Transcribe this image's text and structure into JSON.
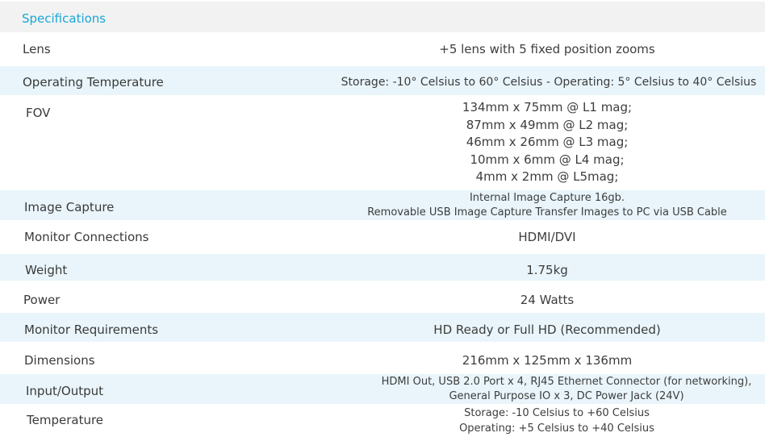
{
  "header": {
    "title": "Specifications"
  },
  "rows": [
    {
      "label": "Lens",
      "value": [
        "+5 lens with 5 fixed position zooms"
      ]
    },
    {
      "label": "Operating Temperature",
      "value": [
        "Storage: -10° Celsius to 60° Celsius - Operating: 5° Celsius to 40° Celsius"
      ]
    },
    {
      "label": "FOV",
      "value": [
        "134mm x 75mm @ L1 mag;",
        "87mm x 49mm @ L2 mag;",
        "46mm x 26mm @ L3 mag;",
        "10mm x 6mm @ L4 mag;",
        "4mm x 2mm @ L5mag;"
      ]
    },
    {
      "label": "Image Capture",
      "value": [
        "Internal Image Capture 16gb.",
        "Removable USB Image Capture Transfer Images to PC via USB Cable"
      ]
    },
    {
      "label": "Monitor Connections",
      "value": [
        "HDMI/DVI"
      ]
    },
    {
      "label": "Weight",
      "value": [
        "1.75kg"
      ]
    },
    {
      "label": "Power",
      "value": [
        "24 Watts"
      ]
    },
    {
      "label": "Monitor Requirements",
      "value": [
        "HD Ready or Full HD (Recommended)"
      ]
    },
    {
      "label": "Dimensions",
      "value": [
        "216mm x 125mm x 136mm"
      ]
    },
    {
      "label": "Input/Output",
      "value": [
        "HDMI Out, USB 2.0 Port x 4, RJ45 Ethernet Connector (for networking),",
        "General Purpose IO x 3, DC Power Jack (24V)"
      ]
    },
    {
      "label": "Temperature",
      "value": [
        "Storage: -10 Celsius to +60 Celsius",
        "Operating: +5 Celsius to +40 Celsius"
      ]
    }
  ]
}
